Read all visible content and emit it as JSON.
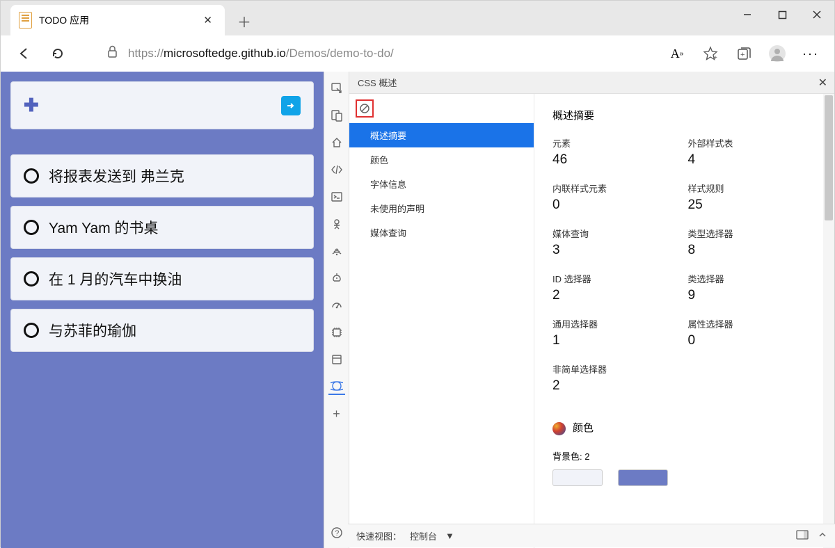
{
  "browser": {
    "tab_title": "TODO 应用",
    "url_host": "https://",
    "url_domain": "microsoftedge.github.io",
    "url_path": "/Demos/demo-to-do/"
  },
  "page": {
    "todos": [
      "将报表发送到 弗兰克",
      "Yam Yam 的书桌",
      "在 1 月的汽车中换油",
      "与苏菲的瑜伽"
    ]
  },
  "devtools": {
    "panel_title": "CSS 概述",
    "nav": [
      "概述摘要",
      "颜色",
      "字体信息",
      "未使用的声明",
      "媒体查询"
    ],
    "summary_title": "概述摘要",
    "stats": [
      {
        "label": "元素",
        "value": "46"
      },
      {
        "label": "外部样式表",
        "value": "4"
      },
      {
        "label": "内联样式元素",
        "value": "0"
      },
      {
        "label": "样式规则",
        "value": "25"
      },
      {
        "label": "媒体查询",
        "value": "3"
      },
      {
        "label": "类型选择器",
        "value": "8"
      },
      {
        "label": "ID 选择器",
        "value": "2"
      },
      {
        "label": "类选择器",
        "value": "9"
      },
      {
        "label": "通用选择器",
        "value": "1"
      },
      {
        "label": "属性选择器",
        "value": "0"
      },
      {
        "label": "非简单选择器",
        "value": "2"
      }
    ],
    "color_title": "颜色",
    "bgcolor_label": "背景色: 2",
    "swatches": [
      "#f1f3f9",
      "#6c7bc4"
    ],
    "footer_label": "快速视图：",
    "footer_value": "控制台"
  }
}
